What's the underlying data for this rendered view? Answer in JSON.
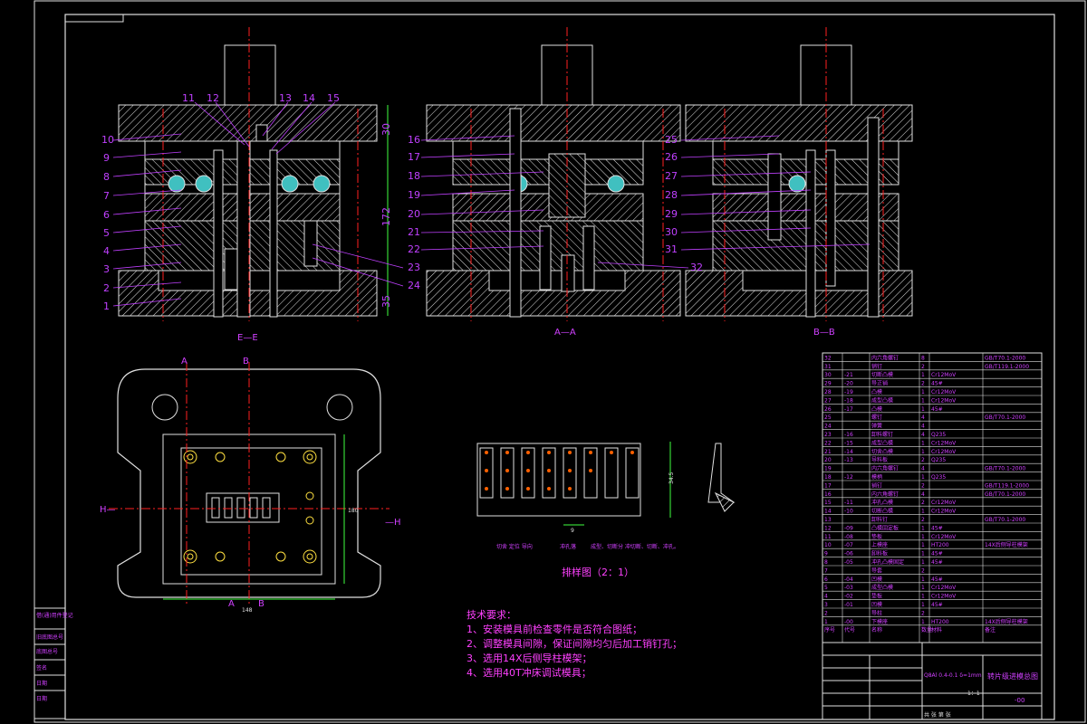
{
  "section_labels": {
    "s1": "E—E",
    "s2": "A—A",
    "s3": "B—B"
  },
  "part_numbers_left_view": [
    "1",
    "2",
    "3",
    "4",
    "5",
    "6",
    "7",
    "8",
    "9",
    "10",
    "11",
    "12",
    "13",
    "14",
    "15",
    "23",
    "24"
  ],
  "part_numbers_mid_view": [
    "16",
    "17",
    "18",
    "19",
    "20",
    "21",
    "22",
    "32"
  ],
  "part_numbers_right_view": [
    "25",
    "26",
    "27",
    "28",
    "29",
    "30",
    "31"
  ],
  "dimensions": {
    "top_plate": "30",
    "height_total": "172",
    "bottom": "35",
    "width_plan": "148",
    "height_plan": "180",
    "strip_width": "34.5",
    "pitch": "9"
  },
  "plan_markers": {
    "a_top": "A",
    "b_top": "B",
    "a_bottom": "A",
    "b_bottom": "B",
    "h_left": "H—",
    "h_right": "—H"
  },
  "layout_title": "排样图（2：1）",
  "layout_notes": [
    "切舍 定位 导向",
    "冲孔落",
    "成型、切断分 冲切断、切断、冲孔。"
  ],
  "tech_req": {
    "title": "技术要求：",
    "items": [
      "1、安装模具前检查零件是否符合图纸；",
      "2、调整模具间隙，保证间隙均匀后加工销钉孔；",
      "3、选用14X后侧导柱模架；",
      "4、选用40T冲床调试模具；"
    ]
  },
  "bom_rows": [
    {
      "no": "32",
      "code": "",
      "name": "内六角螺钉",
      "qty": "8",
      "mat": "",
      "std": "GB/T70.1-2000"
    },
    {
      "no": "31",
      "code": "",
      "name": "销钉",
      "qty": "2",
      "mat": "",
      "std": "GB/T119.1-2000"
    },
    {
      "no": "30",
      "code": "-21",
      "name": "切断凸模",
      "qty": "1",
      "mat": "Cr12MoV",
      "std": ""
    },
    {
      "no": "29",
      "code": "-20",
      "name": "导正销",
      "qty": "2",
      "mat": "45#",
      "std": ""
    },
    {
      "no": "28",
      "code": "-19",
      "name": "凸模",
      "qty": "1",
      "mat": "Cr12MoV",
      "std": ""
    },
    {
      "no": "27",
      "code": "-18",
      "name": "成型凸模",
      "qty": "1",
      "mat": "Cr12MoV",
      "std": ""
    },
    {
      "no": "26",
      "code": "-17",
      "name": "凸模",
      "qty": "1",
      "mat": "45#",
      "std": ""
    },
    {
      "no": "25",
      "code": "",
      "name": "螺钉",
      "qty": "4",
      "mat": "",
      "std": "GB/T70.1-2000"
    },
    {
      "no": "24",
      "code": "",
      "name": "弹簧",
      "qty": "4",
      "mat": "",
      "std": ""
    },
    {
      "no": "23",
      "code": "-16",
      "name": "卸料螺钉",
      "qty": "4",
      "mat": "Q235",
      "std": ""
    },
    {
      "no": "22",
      "code": "-15",
      "name": "成型凸模",
      "qty": "1",
      "mat": "Cr12MoV",
      "std": ""
    },
    {
      "no": "21",
      "code": "-14",
      "name": "切舍凸模",
      "qty": "1",
      "mat": "Cr12MoV",
      "std": ""
    },
    {
      "no": "20",
      "code": "-13",
      "name": "导料板",
      "qty": "2",
      "mat": "Q235",
      "std": ""
    },
    {
      "no": "19",
      "code": "",
      "name": "内六角螺钉",
      "qty": "4",
      "mat": "",
      "std": "GB/T70.1-2000"
    },
    {
      "no": "18",
      "code": "-12",
      "name": "模柄",
      "qty": "1",
      "mat": "Q235",
      "std": ""
    },
    {
      "no": "17",
      "code": "",
      "name": "销钉",
      "qty": "2",
      "mat": "",
      "std": "GB/T119.1-2000"
    },
    {
      "no": "16",
      "code": "",
      "name": "内六角螺钉",
      "qty": "4",
      "mat": "",
      "std": "GB/T70.1-2000"
    },
    {
      "no": "15",
      "code": "-11",
      "name": "冲孔凸模",
      "qty": "2",
      "mat": "Cr12MoV",
      "std": ""
    },
    {
      "no": "14",
      "code": "-10",
      "name": "切断凸模",
      "qty": "1",
      "mat": "Cr12MoV",
      "std": ""
    },
    {
      "no": "13",
      "code": "",
      "name": "卸料钉",
      "qty": "2",
      "mat": "",
      "std": "GB/T70.1-2000"
    },
    {
      "no": "12",
      "code": "-09",
      "name": "凸模固定板",
      "qty": "1",
      "mat": "45#",
      "std": ""
    },
    {
      "no": "11",
      "code": "-08",
      "name": "垫板",
      "qty": "1",
      "mat": "Cr12MoV",
      "std": ""
    },
    {
      "no": "10",
      "code": "-07",
      "name": "上模座",
      "qty": "1",
      "mat": "HT200",
      "std": "14X后侧导柱模架"
    },
    {
      "no": "9",
      "code": "-06",
      "name": "卸料板",
      "qty": "1",
      "mat": "45#",
      "std": ""
    },
    {
      "no": "8",
      "code": "-05",
      "name": "冲孔凸模固定",
      "qty": "1",
      "mat": "45#",
      "std": ""
    },
    {
      "no": "7",
      "code": "",
      "name": "导套",
      "qty": "2",
      "mat": "",
      "std": ""
    },
    {
      "no": "6",
      "code": "-04",
      "name": "凹模",
      "qty": "1",
      "mat": "45#",
      "std": ""
    },
    {
      "no": "5",
      "code": "-03",
      "name": "成型凸模",
      "qty": "1",
      "mat": "Cr12MoV",
      "std": ""
    },
    {
      "no": "4",
      "code": "-02",
      "name": "垫板",
      "qty": "1",
      "mat": "Cr12MoV",
      "std": ""
    },
    {
      "no": "3",
      "code": "-01",
      "name": "凹模",
      "qty": "1",
      "mat": "45#",
      "std": ""
    },
    {
      "no": "2",
      "code": "",
      "name": "导柱",
      "qty": "2",
      "mat": "",
      "std": ""
    },
    {
      "no": "1",
      "code": "-00",
      "name": "下模座",
      "qty": "1",
      "mat": "HT200",
      "std": "14X后侧导柱模架"
    }
  ],
  "bom_header": {
    "no": "序号",
    "code": "代号",
    "name": "名称",
    "qty": "数量",
    "mat": "材料",
    "std": "备注"
  },
  "title_block": {
    "drawing_title": "转片级进模总图",
    "material": "Q8Al 0.4-0.1 δ=1mm",
    "drawing_no": "-00",
    "scale": "1：1",
    "sheets": "共 张  第 张"
  },
  "side_stamp": [
    "借(通)用件登记",
    "旧底图总号",
    "底图总号",
    "签名",
    "日期",
    "日期"
  ]
}
